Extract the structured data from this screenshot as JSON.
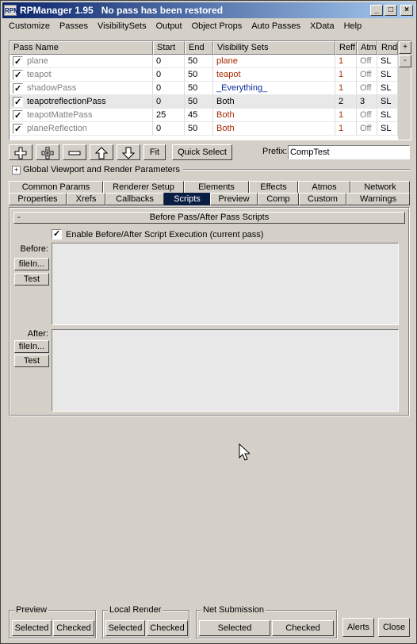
{
  "window": {
    "app_icon_label": "RPM",
    "title": "RPManager 1.95   No pass has been restored"
  },
  "menubar": [
    "Customize",
    "Passes",
    "VisibilitySets",
    "Output",
    "Object Props",
    "Auto Passes",
    "XData",
    "Help"
  ],
  "pass_list": {
    "columns": [
      "Pass Name",
      "Start",
      "End",
      "Visibility Sets",
      "Reff",
      "Atm",
      "Rndr"
    ],
    "rows": [
      {
        "name": "plane",
        "start": "0",
        "end": "50",
        "vis": "plane",
        "reff": "1",
        "atm": "Off",
        "rndr": "SL",
        "style": "dim",
        "vis_style": "red"
      },
      {
        "name": "teapot",
        "start": "0",
        "end": "50",
        "vis": "teapot",
        "reff": "1",
        "atm": "Off",
        "rndr": "SL",
        "style": "dim",
        "vis_style": "red"
      },
      {
        "name": "shadowPass",
        "start": "0",
        "end": "50",
        "vis": "_Everything_",
        "reff": "1",
        "atm": "Off",
        "rndr": "SL",
        "style": "dim",
        "vis_style": "blue"
      },
      {
        "name": "teapotreflectionPass",
        "start": "0",
        "end": "50",
        "vis": "Both",
        "reff": "2",
        "atm": "3",
        "rndr": "SL",
        "style": "normal",
        "vis_style": "normal"
      },
      {
        "name": "teapotMattePass",
        "start": "25",
        "end": "45",
        "vis": "Both",
        "reff": "1",
        "atm": "Off",
        "rndr": "SL",
        "style": "dim",
        "vis_style": "red"
      },
      {
        "name": "planeReflection",
        "start": "0",
        "end": "50",
        "vis": "Both",
        "reff": "1",
        "atm": "Off",
        "rndr": "SL",
        "style": "dim",
        "vis_style": "red"
      }
    ]
  },
  "toolbar": {
    "fit_label": "Fit",
    "quick_select_label": "Quick Select",
    "prefix_label": "Prefix:",
    "prefix_value": "CompTest"
  },
  "global_rollout": {
    "toggle": "+",
    "label": "Global Viewport and Render Parameters"
  },
  "tabs_row1": [
    "Common Params",
    "Renderer Setup",
    "Elements",
    "Effects",
    "Atmos",
    "Network"
  ],
  "tabs_row2": [
    "Properties",
    "Xrefs",
    "Callbacks",
    "Scripts",
    "Preview",
    "Comp",
    "Custom",
    "Warnings"
  ],
  "active_tab": "Scripts",
  "scripts_panel": {
    "rollout_toggle": "-",
    "rollout_title": "Before Pass/After Pass Scripts",
    "enable_label": "Enable Before/After Script Execution (current pass)",
    "before_label": "Before:",
    "after_label": "After:",
    "filein_label": "fileIn...",
    "test_label": "Test"
  },
  "bottom": {
    "preview_title": "Preview",
    "local_render_title": "Local Render",
    "net_submission_title": "Net Submission",
    "selected_label": "Selected",
    "checked_label": "Checked",
    "alerts_label": "Alerts",
    "close_label": "Close"
  },
  "colors": {
    "title_start": "#0a246a",
    "title_end": "#a6caf0",
    "active_tab": "#0a1e44",
    "vis_red": "#a52a00",
    "vis_blue": "#0a2a9a"
  }
}
